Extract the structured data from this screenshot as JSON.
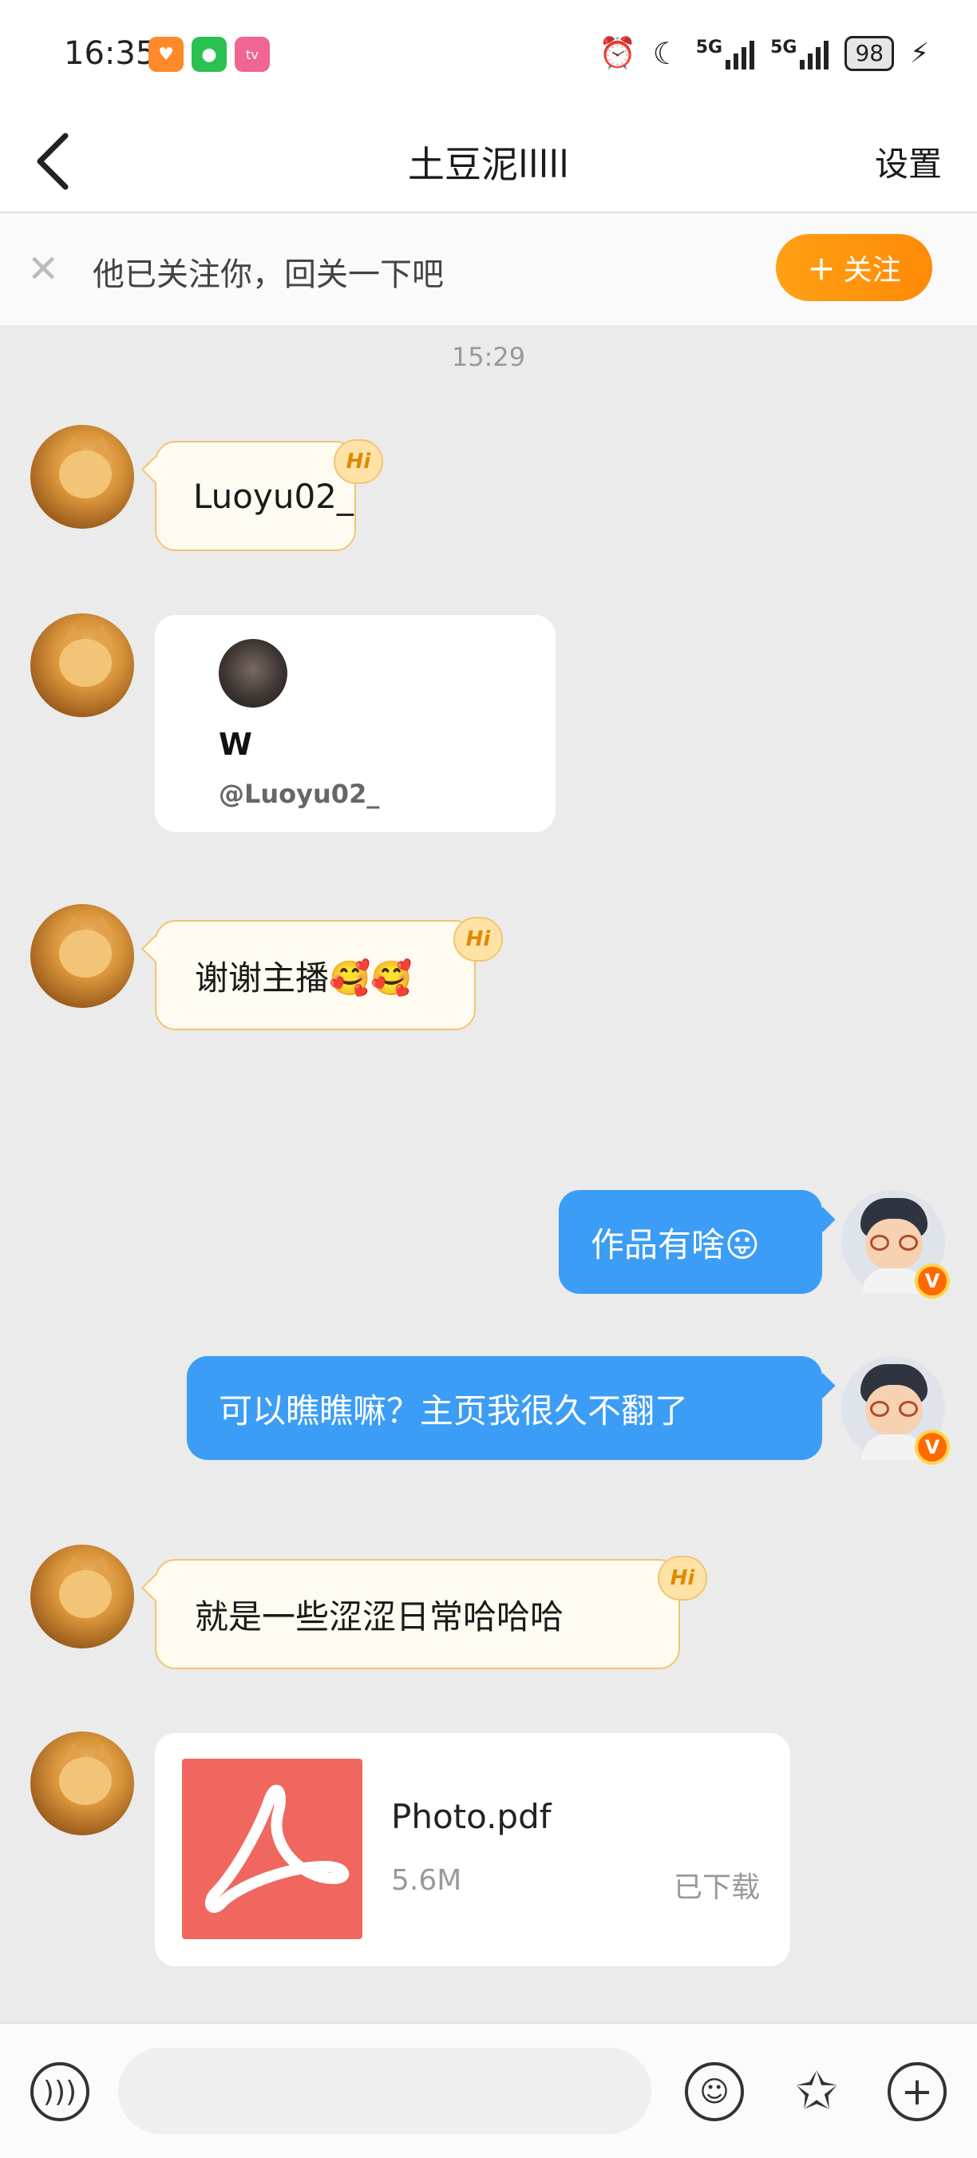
{
  "status_bar": {
    "time": "16:35",
    "network1": "5G",
    "network2": "5G",
    "battery": "98",
    "icons": [
      "app-notification-icon",
      "wechat-icon",
      "bilibili-icon",
      "alarm-icon",
      "moon-icon",
      "signal-icon",
      "charging-icon"
    ]
  },
  "header": {
    "title": "土豆泥lllll",
    "settings_label": "设置"
  },
  "follow_banner": {
    "text": "他已关注你，回关一下吧",
    "button_label": "关注"
  },
  "chat": {
    "timestamp": "15:29",
    "hi_badge": "Hi",
    "messages": [
      {
        "from": "other",
        "type": "text",
        "text": "Luoyu02_"
      },
      {
        "from": "other",
        "type": "profile_card",
        "name": "W",
        "handle": "@Luoyu02_"
      },
      {
        "from": "other",
        "type": "text",
        "text": "谢谢主播🥰🥰"
      },
      {
        "from": "me",
        "type": "text",
        "text": "作品有啥😛"
      },
      {
        "from": "me",
        "type": "text",
        "text": "可以瞧瞧嘛？主页我很久不翻了"
      },
      {
        "from": "other",
        "type": "text",
        "text": "就是一些涩涩日常哈哈哈"
      },
      {
        "from": "other",
        "type": "file",
        "name": "Photo.pdf",
        "size": "5.6M",
        "status": "已下载"
      }
    ]
  },
  "input_bar": {
    "placeholder": "",
    "icons": [
      "voice-icon",
      "emoji-icon",
      "sticker-icon",
      "plus-icon"
    ]
  },
  "colors": {
    "accent_orange": "#ff8a08",
    "outgoing_bubble": "#3b9df5",
    "incoming_bubble_border": "#f0c572",
    "pdf_red": "#ef675e"
  }
}
